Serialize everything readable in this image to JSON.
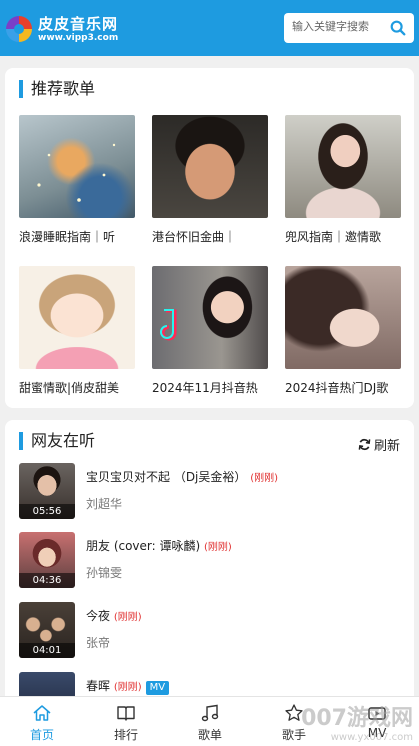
{
  "header": {
    "title": "皮皮音乐网",
    "url": "www.vipp3.com",
    "search_placeholder": "输入关键字搜索"
  },
  "recommend": {
    "title": "推荐歌单",
    "playlists": [
      {
        "name": "浪漫睡眠指南｜听"
      },
      {
        "name": "港台怀旧金曲｜"
      },
      {
        "name": "兜风指南｜邀情歌"
      },
      {
        "name": "甜蜜情歌|俏皮甜美"
      },
      {
        "name": "2024年11月抖音热"
      },
      {
        "name": "2024抖音热门DJ歌"
      }
    ]
  },
  "listening": {
    "title": "网友在听",
    "refresh_label": "刷新",
    "songs": [
      {
        "title": "宝贝宝贝对不起 （Dj吴金裕）",
        "tag": "(刚刚)",
        "artist": "刘超华",
        "duration": "05:56"
      },
      {
        "title": "朋友 (cover: 谭咏麟)",
        "tag": "(刚刚)",
        "artist": "孙锦雯",
        "duration": "04:36"
      },
      {
        "title": "今夜",
        "tag": "(刚刚)",
        "artist": "张帝",
        "duration": "04:01"
      },
      {
        "title": "春晖",
        "tag": "(刚刚)",
        "mv": "MV",
        "artist": "",
        "duration": ""
      }
    ]
  },
  "nav": {
    "items": [
      {
        "label": "首页",
        "icon": "home-icon"
      },
      {
        "label": "排行",
        "icon": "book-icon"
      },
      {
        "label": "歌单",
        "icon": "music-note-icon"
      },
      {
        "label": "歌手",
        "icon": "star-icon"
      },
      {
        "label": "MV",
        "icon": "video-icon"
      }
    ]
  },
  "watermark": {
    "text": "007游戏网",
    "sub": "www.yx007.com"
  },
  "colors": {
    "accent": "#1e9be0",
    "tag_red": "#e03030"
  }
}
